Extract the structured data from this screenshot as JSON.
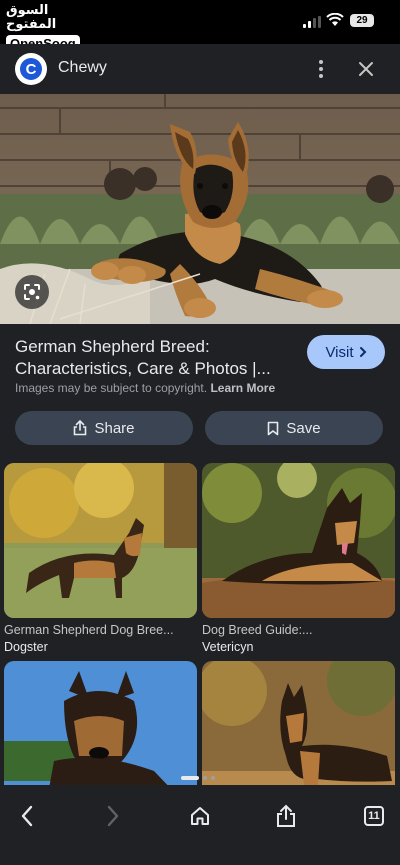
{
  "status_bar": {
    "watermark_arabic": "السوق المفتوح",
    "watermark_brand": "OpenSooq",
    "battery": "29"
  },
  "header": {
    "site_name": "Chewy",
    "site_logo_letter": "C",
    "logo_color": "#1c58d8"
  },
  "result": {
    "title": "German Shepherd Breed: Characteristics, Care & Photos |...",
    "visit_label": "Visit",
    "copyright_text": "Images may be subject to copyright.",
    "learn_more": "Learn More",
    "share_label": "Share",
    "save_label": "Save",
    "accent": "#a8c7fa"
  },
  "related": [
    {
      "caption": "German Shepherd Dog Bree...",
      "source": "Dogster"
    },
    {
      "caption": "Dog Breed Guide:...",
      "source": "Vetericyn"
    },
    {
      "caption": "",
      "source": ""
    },
    {
      "caption": "",
      "source": ""
    }
  ],
  "bottom_bar": {
    "tab_count": "11"
  }
}
